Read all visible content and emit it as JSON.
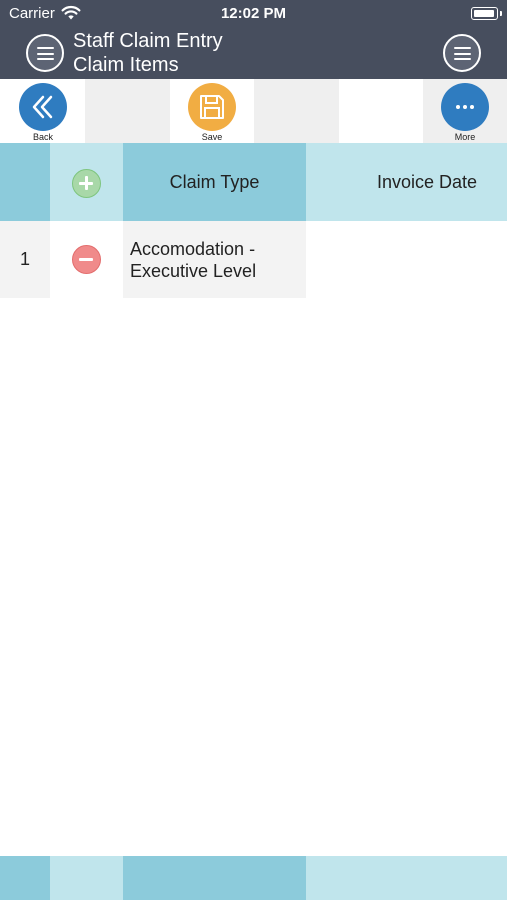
{
  "status": {
    "carrier": "Carrier",
    "time": "12:02 PM"
  },
  "nav": {
    "title_line1": "Staff Claim Entry",
    "title_line2": "Claim Items"
  },
  "toolbar": {
    "back_label": "Back",
    "save_label": "Save",
    "more_label": "More"
  },
  "table": {
    "headers": [
      "Claim Type",
      "Invoice Date"
    ],
    "rows": [
      {
        "index": "1",
        "claim_type_line1": "Accomodation -",
        "claim_type_line2": "Executive Level",
        "invoice_date": ""
      }
    ]
  },
  "colors": {
    "nav_bg": "#474e5e",
    "header_dark": "#8ccbdb",
    "header_light": "#c0e5ec",
    "back_btn": "#2f7cc0",
    "save_btn": "#f1ad43",
    "more_btn": "#2f7cc0",
    "add_btn": "#a8d8a8",
    "remove_btn": "#f08a8a"
  },
  "icons": [
    "wifi-icon",
    "battery-icon",
    "menu-icon",
    "back-chevron-icon",
    "save-floppy-icon",
    "more-dots-icon",
    "add-row-icon",
    "remove-row-icon"
  ]
}
